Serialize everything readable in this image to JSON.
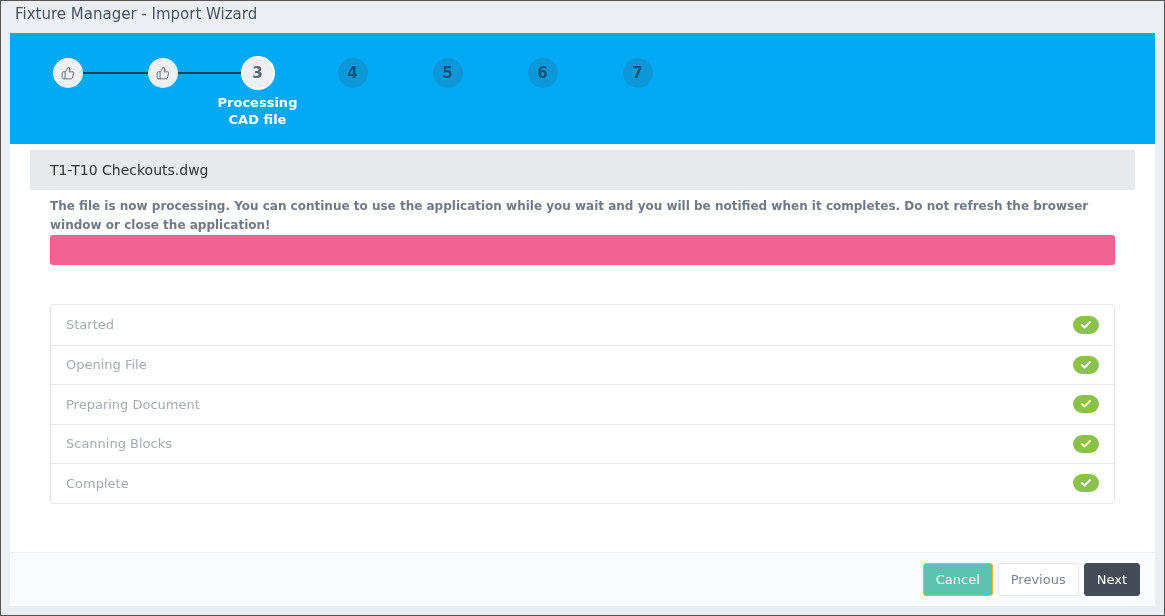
{
  "window": {
    "title": "Fixture Manager - Import Wizard"
  },
  "steps": [
    {
      "done": true,
      "selected": false
    },
    {
      "done": true,
      "selected": false
    },
    {
      "number": "3",
      "done": false,
      "selected": true,
      "label": "Processing CAD file"
    },
    {
      "number": "4",
      "done": false,
      "selected": false
    },
    {
      "number": "5",
      "done": false,
      "selected": false
    },
    {
      "number": "6",
      "done": false,
      "selected": false
    },
    {
      "number": "7",
      "done": false,
      "selected": false
    }
  ],
  "file_name": "T1-T10 Checkouts.dwg",
  "message": "The file is now processing. You can continue to use the application while you wait and you will be notified when it completes. Do not refresh the browser window or close the application!",
  "progress": {
    "level": 1
  },
  "tasks": [
    {
      "label": "Started",
      "done": true
    },
    {
      "label": "Opening File",
      "done": true
    },
    {
      "label": "Preparing Document",
      "done": true
    },
    {
      "label": "Scanning Blocks",
      "done": true
    },
    {
      "label": "Complete",
      "done": true
    }
  ],
  "buttons": [
    {
      "label": "Cancel",
      "kind": "cancel"
    },
    {
      "label": "Previous",
      "kind": "secondary"
    },
    {
      "label": "Next",
      "kind": "primary"
    }
  ]
}
